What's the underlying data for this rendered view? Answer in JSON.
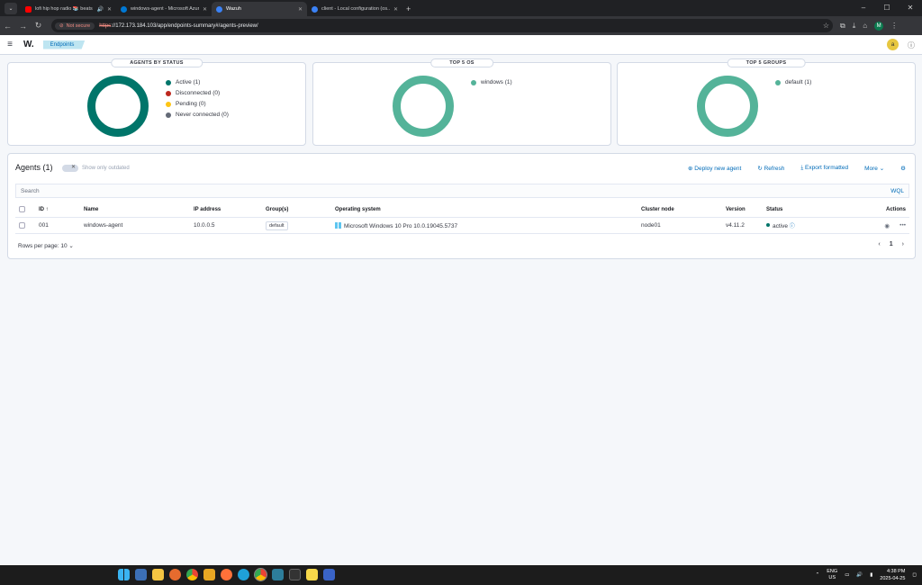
{
  "browser": {
    "tabs": [
      {
        "title": "lofi hip hop radio 📚 beats",
        "color": "#ff0000",
        "active": false
      },
      {
        "title": "windows-agent - Microsoft Azure",
        "color": "#0078d4",
        "active": false
      },
      {
        "title": "Wazuh",
        "color": "#3b82f6",
        "active": true
      },
      {
        "title": "client - Local configuration (os...",
        "color": "#3b82f6",
        "active": false
      }
    ],
    "security_label": "Not secure",
    "url_protocol": "https",
    "url_rest": "://172.173.184.103/app/endpoints-summary#/agents-preview/",
    "profile_initial": "M"
  },
  "app": {
    "logo": "W.",
    "breadcrumb": "Endpoints",
    "user_initial": "a"
  },
  "panels": {
    "status": {
      "title": "AGENTS BY STATUS",
      "legend": [
        {
          "label": "Active (1)",
          "color": "#00756a"
        },
        {
          "label": "Disconnected (0)",
          "color": "#bd271e"
        },
        {
          "label": "Pending (0)",
          "color": "#fec514"
        },
        {
          "label": "Never connected (0)",
          "color": "#646a77"
        }
      ]
    },
    "os": {
      "title": "TOP 5 OS",
      "legend": [
        {
          "label": "windows (1)",
          "color": "#54b399"
        }
      ]
    },
    "groups": {
      "title": "TOP 5 GROUPS",
      "legend": [
        {
          "label": "default (1)",
          "color": "#54b399"
        }
      ]
    }
  },
  "agents": {
    "title": "Agents (1)",
    "toggle_label": "Show only outdated",
    "actions": {
      "deploy": "Deploy new agent",
      "refresh": "Refresh",
      "export": "Export formatted",
      "more": "More"
    },
    "search_placeholder": "Search",
    "wql": "WQL",
    "columns": {
      "id": "ID ↑",
      "name": "Name",
      "ip": "IP address",
      "groups": "Group(s)",
      "os": "Operating system",
      "node": "Cluster node",
      "version": "Version",
      "status": "Status",
      "actions": "Actions"
    },
    "row": {
      "id": "001",
      "name": "windows-agent",
      "ip": "10.0.0.5",
      "group": "default",
      "os": "Microsoft Windows 10 Pro 10.0.19045.5737",
      "node": "node01",
      "version": "v4.11.2",
      "status": "active"
    },
    "rows_per_page": "Rows per page: 10",
    "page": "1"
  },
  "taskbar": {
    "lang": "ENG",
    "region": "US",
    "time": "4:38 PM",
    "date": "2025-04-25"
  }
}
